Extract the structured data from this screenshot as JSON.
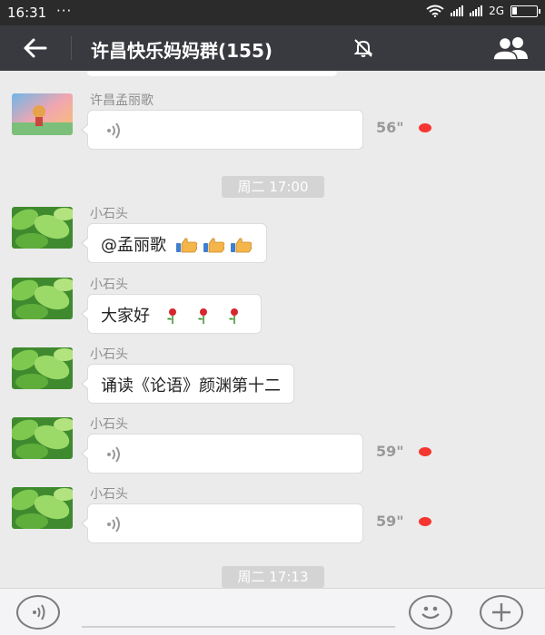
{
  "status_bar": {
    "time": "16:31",
    "dots": "···",
    "network": "2G",
    "icons": [
      "wifi-icon",
      "signal-icon",
      "signal-icon",
      "battery-icon"
    ]
  },
  "header": {
    "title": "许昌快乐妈妈群(155)",
    "icons": [
      "back-arrow-icon",
      "mute-bell-icon",
      "group-members-icon"
    ]
  },
  "timestamps": [
    "周二 17:00",
    "周二 17:13"
  ],
  "messages": [
    {
      "sender": "许昌孟丽歌",
      "type": "voice",
      "duration": "56\"",
      "unread": true
    },
    {
      "sender": "小石头",
      "type": "text",
      "text": "@孟丽歌",
      "emoji": [
        "thumbs-up-icon",
        "thumbs-up-icon",
        "thumbs-up-icon"
      ]
    },
    {
      "sender": "小石头",
      "type": "text",
      "text": "大家好",
      "emoji": [
        "rose-icon",
        "rose-icon",
        "rose-icon"
      ]
    },
    {
      "sender": "小石头",
      "type": "text",
      "text": "诵读《论语》颜渊第十二"
    },
    {
      "sender": "小石头",
      "type": "voice",
      "duration": "59\"",
      "unread": true
    },
    {
      "sender": "小石头",
      "type": "voice",
      "duration": "59\"",
      "unread": true
    }
  ],
  "input_bar": {
    "icons": [
      "voice-input-icon",
      "emoji-icon",
      "plus-icon"
    ]
  },
  "colors": {
    "title_bar": "#393a3f",
    "status_bar": "#2b2b2b",
    "chat_bg": "#ebebeb",
    "unread_dot": "#f43530"
  }
}
